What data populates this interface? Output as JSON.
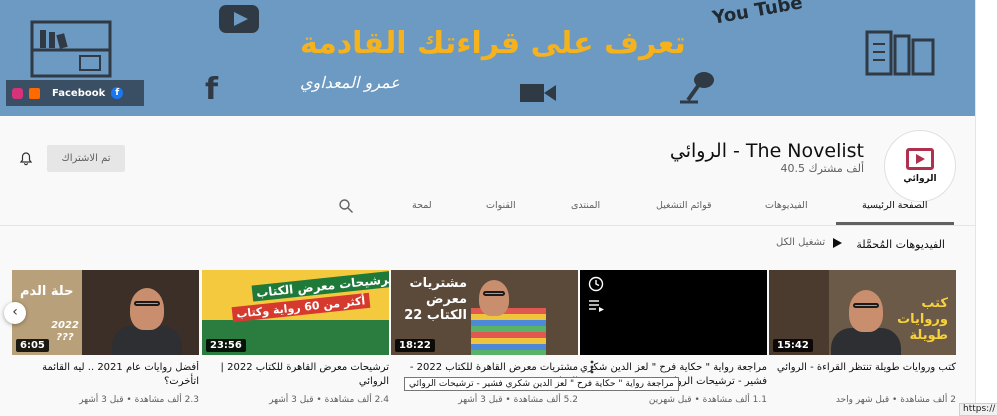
{
  "banner": {
    "headline": "تعرف على قراءتك القادمة",
    "author": "عمرو المعداوي",
    "youtube_text": "You Tube",
    "social": {
      "facebook_label": "Facebook"
    }
  },
  "channel": {
    "avatar_label": "الروائي",
    "title": "الروائي - The Novelist",
    "subscribers": "40.5 ألف مشترك",
    "subscribed_label": "تم الاشتراك"
  },
  "tabs": [
    {
      "label": "الصفحة الرئيسية",
      "active": true
    },
    {
      "label": "الفيديوهات",
      "active": false
    },
    {
      "label": "قوائم التشغيل",
      "active": false
    },
    {
      "label": "المنتدى",
      "active": false
    },
    {
      "label": "القنوات",
      "active": false
    },
    {
      "label": "لمحة",
      "active": false
    }
  ],
  "section": {
    "title": "الفيديوهات المُحمَّلة",
    "play_all": "تشغيل الكل"
  },
  "videos": [
    {
      "duration": "15:42",
      "title": "كتب وروايات طويلة تنتظر القراءة - الروائي",
      "meta": "2 ألف مشاهدة • قبل شهر واحد",
      "overlay": "كتب وروايات طويلة"
    },
    {
      "duration": "",
      "title": "مراجعة رواية \" حكاية فرح \" لعز الدين شكري فشير - ترشيحات الروائي",
      "meta": "1.1 ألف مشاهدة • قبل شهرين",
      "overlay": ""
    },
    {
      "duration": "18:22",
      "title": "مشتريات معرض القاهرة للكتاب 2022 - الروائي",
      "meta": "5.2 ألف مشاهدة • قبل 3 أشهر",
      "overlay": "مشتريات معرض الكتاب 22"
    },
    {
      "duration": "23:56",
      "title": "ترشيحات معرض القاهرة للكتاب 2022 | الروائي",
      "meta": "2.4 ألف مشاهدة • قبل 3 أشهر",
      "overlay": "ترشيحات معرض الكتاب",
      "overlay2": "أكثر من 60 رواية وكتاب"
    },
    {
      "duration": "6:05",
      "title": "أفضل روايات عام 2021 .. ليه القائمة اتأخرت؟",
      "meta": "2.3 ألف مشاهدة • قبل 3 أشهر",
      "overlay": "حلة الدم",
      "overlay2": "2022 ???"
    }
  ],
  "tooltip": "مراجعة رواية \" حكاية فرح \" لعز الدين شكري فشير - ترشيحات الروائي",
  "status_url": "https://",
  "colors": {
    "banner_bg": "#6d9ac2",
    "headline": "#f6b21d",
    "accent_red": "#b0304e"
  }
}
